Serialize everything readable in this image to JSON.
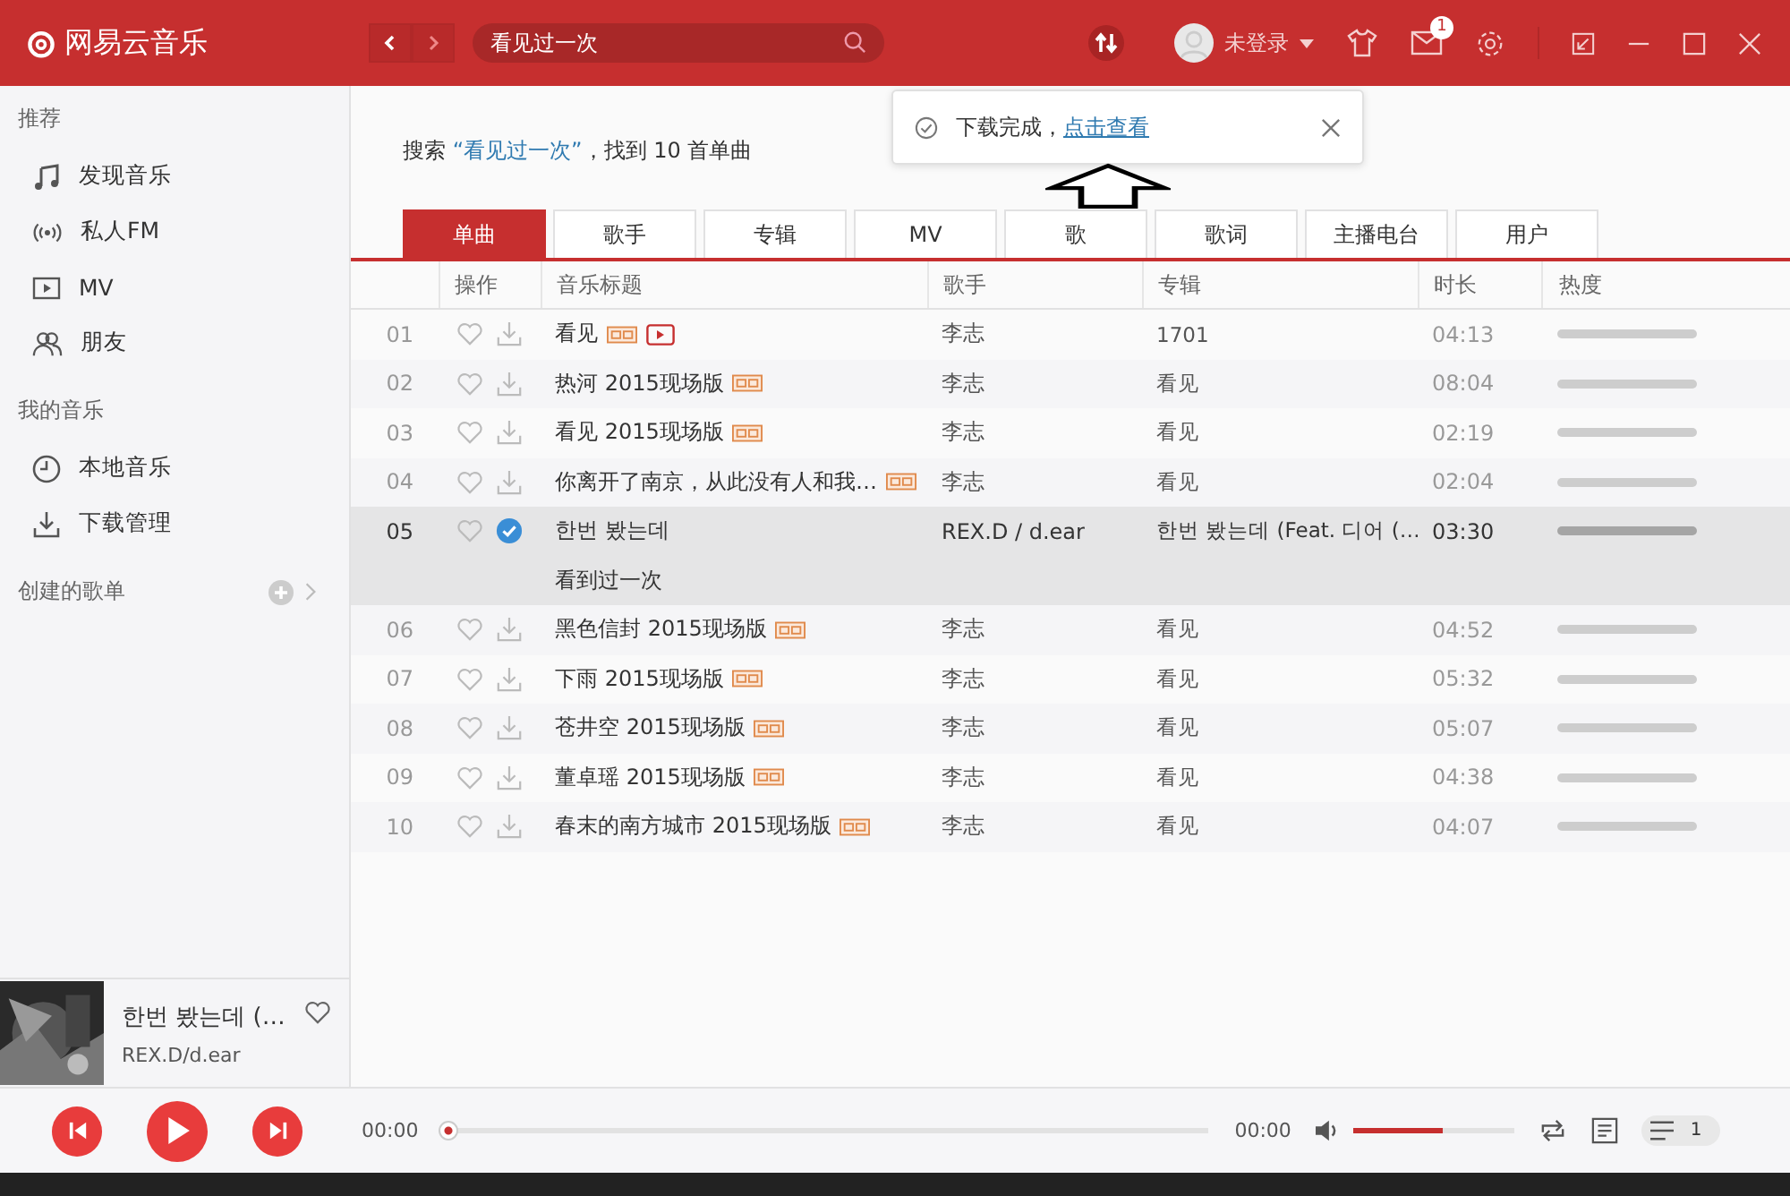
{
  "app": {
    "name": "网易云音乐"
  },
  "search": {
    "value": "看见过一次"
  },
  "user": {
    "name": "未登录"
  },
  "messages": {
    "badge": "1"
  },
  "toast": {
    "text": "下载完成，",
    "link": "点击查看"
  },
  "sidebar": {
    "sections": [
      {
        "title": "推荐",
        "items": [
          {
            "label": "发现音乐",
            "kind": "music"
          },
          {
            "label": "私人FM",
            "kind": "radio"
          },
          {
            "label": "MV",
            "kind": "video"
          },
          {
            "label": "朋友",
            "kind": "friends"
          }
        ]
      },
      {
        "title": "我的音乐",
        "items": [
          {
            "label": "本地音乐",
            "kind": "clock"
          },
          {
            "label": "下载管理",
            "kind": "download"
          }
        ]
      }
    ],
    "playlists": {
      "title": "创建的歌单"
    }
  },
  "result": {
    "prefix": "搜索",
    "query": "“看见过一次”",
    "suffix": "，找到 10 首单曲"
  },
  "tabs": [
    {
      "label": "单曲",
      "selected": true
    },
    {
      "label": "歌手",
      "selected": false
    },
    {
      "label": "专辑",
      "selected": false
    },
    {
      "label": "MV",
      "selected": false
    },
    {
      "label": "歌",
      "selected": false
    },
    {
      "label": "歌词",
      "selected": false
    },
    {
      "label": "主播电台",
      "selected": false
    },
    {
      "label": "用户",
      "selected": false
    }
  ],
  "table": {
    "columns": [
      "操作",
      "音乐标题",
      "歌手",
      "专辑",
      "时长",
      "热度"
    ],
    "rows": [
      {
        "index": "01",
        "title": "看见",
        "sq": true,
        "mv": true,
        "artist": "李志",
        "album": "1701",
        "duration": "04:13",
        "level": 1,
        "selected": false,
        "downloaded": false
      },
      {
        "index": "02",
        "title": "热河 2015现场版",
        "sq": true,
        "mv": false,
        "artist": "李志",
        "album": "看见",
        "duration": "08:04",
        "level": 1,
        "selected": false,
        "downloaded": false
      },
      {
        "index": "03",
        "title": "看见 2015现场版",
        "sq": true,
        "mv": false,
        "artist": "李志",
        "album": "看见",
        "duration": "02:19",
        "level": 1,
        "selected": false,
        "downloaded": false
      },
      {
        "index": "04",
        "title": "你离开了南京，从此没有人和我…",
        "sq": true,
        "mv": false,
        "artist": "李志",
        "album": "看见",
        "duration": "02:04",
        "level": 1,
        "selected": false,
        "downloaded": false
      },
      {
        "index": "05",
        "title": "한번 봤는데",
        "subtitle": "看到过一次",
        "sq": false,
        "mv": false,
        "artist": "REX.D / d.ear",
        "album": "한번 봤는데 (Feat. 디어 (…",
        "duration": "03:30",
        "level": 1,
        "selected": true,
        "downloaded": true
      },
      {
        "index": "06",
        "title": "黑色信封 2015现场版",
        "sq": true,
        "mv": false,
        "artist": "李志",
        "album": "看见",
        "duration": "04:52",
        "level": 1,
        "selected": false,
        "downloaded": false
      },
      {
        "index": "07",
        "title": "下雨 2015现场版",
        "sq": true,
        "mv": false,
        "artist": "李志",
        "album": "看见",
        "duration": "05:32",
        "level": 1,
        "selected": false,
        "downloaded": false
      },
      {
        "index": "08",
        "title": "苍井空 2015现场版",
        "sq": true,
        "mv": false,
        "artist": "李志",
        "album": "看见",
        "duration": "05:07",
        "level": 1,
        "selected": false,
        "downloaded": false
      },
      {
        "index": "09",
        "title": "董卓瑶 2015现场版",
        "sq": true,
        "mv": false,
        "artist": "李志",
        "album": "看见",
        "duration": "04:38",
        "level": 1,
        "selected": false,
        "downloaded": false
      },
      {
        "index": "10",
        "title": "春末的南方城市 2015现场版",
        "sq": true,
        "mv": false,
        "artist": "李志",
        "album": "看见",
        "duration": "04:07",
        "level": 1,
        "selected": false,
        "downloaded": false
      }
    ]
  },
  "now_playing": {
    "title": "한번 봤는데 (…",
    "artist": "REX.D/d.ear"
  },
  "player": {
    "elapsed": "00:00",
    "total": "00:00",
    "progress": {
      "level": 0
    },
    "volume": {
      "level": 0.55
    },
    "queue_count": "1"
  }
}
